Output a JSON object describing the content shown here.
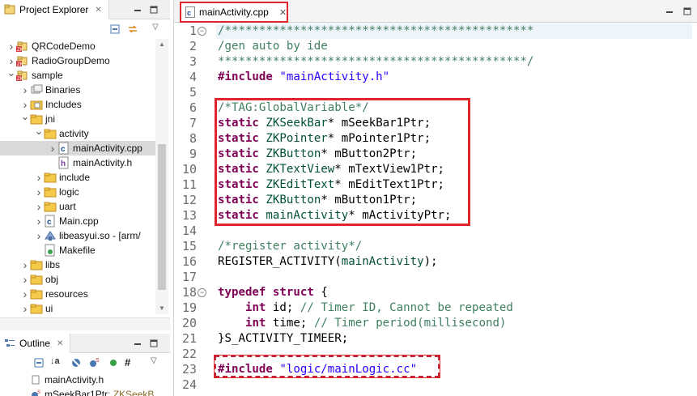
{
  "project_explorer": {
    "title": "Project Explorer",
    "tree": [
      {
        "label": "QRCodeDemo",
        "depth": 0,
        "twisty": "collapsed",
        "icon": "project-icon"
      },
      {
        "label": "RadioGroupDemo",
        "depth": 0,
        "twisty": "collapsed",
        "icon": "project-icon"
      },
      {
        "label": "sample",
        "depth": 0,
        "twisty": "expanded",
        "icon": "project-icon"
      },
      {
        "label": "Binaries",
        "depth": 1,
        "twisty": "collapsed",
        "icon": "binaries-icon"
      },
      {
        "label": "Includes",
        "depth": 1,
        "twisty": "collapsed",
        "icon": "includes-icon"
      },
      {
        "label": "jni",
        "depth": 1,
        "twisty": "expanded",
        "icon": "folder-icon"
      },
      {
        "label": "activity",
        "depth": 2,
        "twisty": "expanded",
        "icon": "folder-icon"
      },
      {
        "label": "mainActivity.cpp",
        "depth": 3,
        "twisty": "collapsed",
        "icon": "cpp-file-icon",
        "selected": true
      },
      {
        "label": "mainActivity.h",
        "depth": 3,
        "twisty": "none",
        "icon": "header-file-icon"
      },
      {
        "label": "include",
        "depth": 2,
        "twisty": "collapsed",
        "icon": "folder-icon"
      },
      {
        "label": "logic",
        "depth": 2,
        "twisty": "collapsed",
        "icon": "folder-icon"
      },
      {
        "label": "uart",
        "depth": 2,
        "twisty": "collapsed",
        "icon": "folder-icon"
      },
      {
        "label": "Main.cpp",
        "depth": 2,
        "twisty": "collapsed",
        "icon": "cpp-file-icon"
      },
      {
        "label": "libeasyui.so - [arm/",
        "depth": 2,
        "twisty": "collapsed",
        "icon": "library-icon"
      },
      {
        "label": "Makefile",
        "depth": 2,
        "twisty": "none",
        "icon": "makefile-icon"
      },
      {
        "label": "libs",
        "depth": 1,
        "twisty": "collapsed",
        "icon": "folder-icon"
      },
      {
        "label": "obj",
        "depth": 1,
        "twisty": "collapsed",
        "icon": "folder-icon"
      },
      {
        "label": "resources",
        "depth": 1,
        "twisty": "collapsed",
        "icon": "folder-icon"
      },
      {
        "label": "ui",
        "depth": 1,
        "twisty": "collapsed",
        "icon": "folder-icon"
      }
    ]
  },
  "outline": {
    "title": "Outline",
    "items": [
      {
        "label": "mainActivity.h",
        "icon": "include-icon"
      },
      {
        "label": "mSeekBar1Ptr",
        "suffix": " : ZKSeekB",
        "icon": "static-field-icon"
      }
    ]
  },
  "editor": {
    "tab_label": "mainActivity.cpp",
    "lines": [
      {
        "n": "1",
        "fold": "minus",
        "tokens": [
          {
            "c": "cm",
            "t": "/*********************************************"
          }
        ]
      },
      {
        "n": "2",
        "tokens": [
          {
            "c": "cm",
            "t": "/gen auto by ide"
          }
        ]
      },
      {
        "n": "3",
        "tokens": [
          {
            "c": "cm",
            "t": "*********************************************/"
          }
        ]
      },
      {
        "n": "4",
        "tokens": [
          {
            "c": "kw",
            "t": "#include"
          },
          {
            "c": "",
            "t": " "
          },
          {
            "c": "str",
            "t": "\"mainActivity.h\""
          }
        ]
      },
      {
        "n": "5",
        "tokens": []
      },
      {
        "n": "6",
        "tokens": [
          {
            "c": "cm",
            "t": "/*TAG:GlobalVariable*/"
          }
        ]
      },
      {
        "n": "7",
        "tokens": [
          {
            "c": "kw",
            "t": "static"
          },
          {
            "c": "",
            "t": " "
          },
          {
            "c": "ty",
            "t": "ZKSeekBar"
          },
          {
            "c": "",
            "t": "* mSeekBar1Ptr;"
          }
        ]
      },
      {
        "n": "8",
        "tokens": [
          {
            "c": "kw",
            "t": "static"
          },
          {
            "c": "",
            "t": " "
          },
          {
            "c": "ty",
            "t": "ZKPointer"
          },
          {
            "c": "",
            "t": "* mPointer1Ptr;"
          }
        ]
      },
      {
        "n": "9",
        "tokens": [
          {
            "c": "kw",
            "t": "static"
          },
          {
            "c": "",
            "t": " "
          },
          {
            "c": "ty",
            "t": "ZKButton"
          },
          {
            "c": "",
            "t": "* mButton2Ptr;"
          }
        ]
      },
      {
        "n": "10",
        "tokens": [
          {
            "c": "kw",
            "t": "static"
          },
          {
            "c": "",
            "t": " "
          },
          {
            "c": "ty",
            "t": "ZKTextView"
          },
          {
            "c": "",
            "t": "* mTextView1Ptr;"
          }
        ]
      },
      {
        "n": "11",
        "tokens": [
          {
            "c": "kw",
            "t": "static"
          },
          {
            "c": "",
            "t": " "
          },
          {
            "c": "ty",
            "t": "ZKEditText"
          },
          {
            "c": "",
            "t": "* mEditText1Ptr;"
          }
        ]
      },
      {
        "n": "12",
        "tokens": [
          {
            "c": "kw",
            "t": "static"
          },
          {
            "c": "",
            "t": " "
          },
          {
            "c": "ty",
            "t": "ZKButton"
          },
          {
            "c": "",
            "t": "* mButton1Ptr;"
          }
        ]
      },
      {
        "n": "13",
        "tokens": [
          {
            "c": "kw",
            "t": "static"
          },
          {
            "c": "",
            "t": " "
          },
          {
            "c": "ty",
            "t": "mainActivity"
          },
          {
            "c": "",
            "t": "* mActivityPtr;"
          }
        ]
      },
      {
        "n": "14",
        "tokens": []
      },
      {
        "n": "15",
        "tokens": [
          {
            "c": "cm",
            "t": "/*register activity*/"
          }
        ]
      },
      {
        "n": "16",
        "tokens": [
          {
            "c": "",
            "t": "REGISTER_ACTIVITY("
          },
          {
            "c": "ty",
            "t": "mainActivity"
          },
          {
            "c": "",
            "t": ");"
          }
        ]
      },
      {
        "n": "17",
        "tokens": []
      },
      {
        "n": "18",
        "fold": "minus",
        "tokens": [
          {
            "c": "kw",
            "t": "typedef"
          },
          {
            "c": "",
            "t": " "
          },
          {
            "c": "kw",
            "t": "struct"
          },
          {
            "c": "",
            "t": " {"
          }
        ]
      },
      {
        "n": "19",
        "tokens": [
          {
            "c": "",
            "t": "    "
          },
          {
            "c": "kw",
            "t": "int"
          },
          {
            "c": "",
            "t": " id; "
          },
          {
            "c": "cm",
            "t": "// Timer ID, Cannot be repeated"
          }
        ]
      },
      {
        "n": "20",
        "tokens": [
          {
            "c": "",
            "t": "    "
          },
          {
            "c": "kw",
            "t": "int"
          },
          {
            "c": "",
            "t": " time; "
          },
          {
            "c": "cm",
            "t": "// Timer period(millisecond)"
          }
        ]
      },
      {
        "n": "21",
        "tokens": [
          {
            "c": "",
            "t": "}S_ACTIVITY_TIMEER;"
          }
        ]
      },
      {
        "n": "22",
        "tokens": []
      },
      {
        "n": "23",
        "tokens": [
          {
            "c": "kw",
            "t": "#include"
          },
          {
            "c": "",
            "t": " "
          },
          {
            "c": "str",
            "t": "\"logic/mainLogic.cc\""
          }
        ]
      },
      {
        "n": "24",
        "tokens": []
      }
    ]
  },
  "colors": {
    "highlight_red": "#e0262a",
    "keyword": "#7f0055",
    "comment": "#3f7f5f",
    "string": "#2a00ff"
  }
}
